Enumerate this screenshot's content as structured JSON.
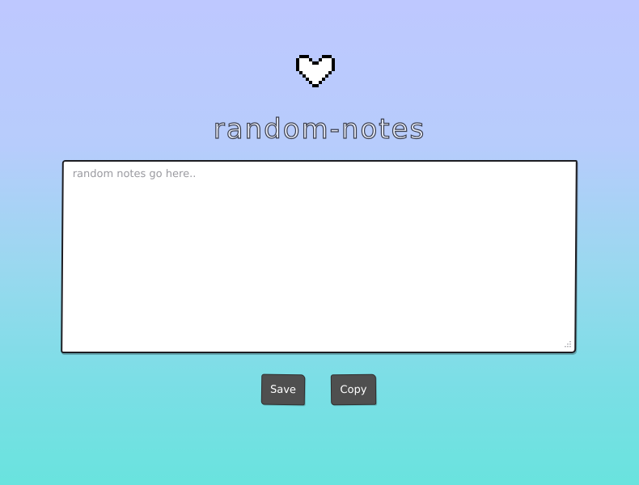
{
  "header": {
    "logo_icon": "pixel-heart-icon",
    "title": "random-notes"
  },
  "editor": {
    "placeholder": "random notes go here..",
    "value": ""
  },
  "actions": {
    "save_label": "Save",
    "copy_label": "Copy"
  },
  "colors": {
    "background_top": "#bec8ff",
    "background_bottom": "#69e3de",
    "button": "#4f4f4f",
    "title_stroke": "#3b3f4e"
  }
}
